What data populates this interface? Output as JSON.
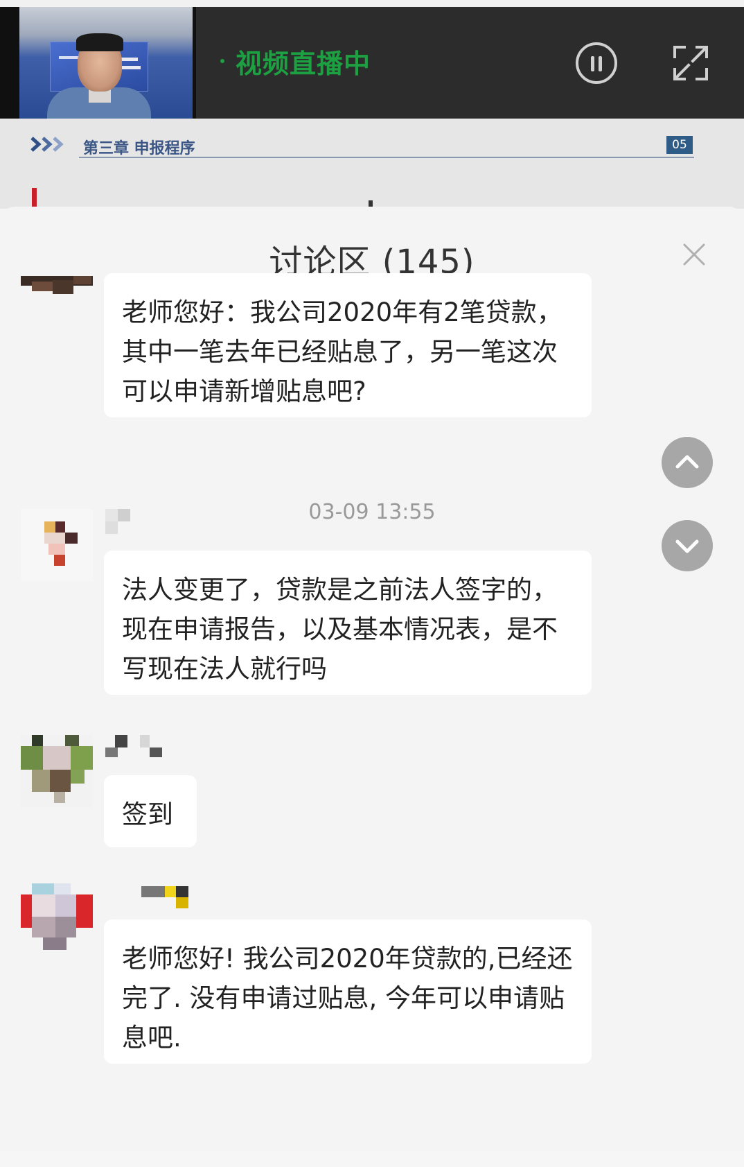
{
  "video": {
    "status_label": "视频直播中",
    "slide": {
      "chapter": "第三章  申报程序",
      "page": "05"
    }
  },
  "discussion": {
    "title": "讨论区 (145)",
    "messages": [
      {
        "text": "老师您好：我公司2020年有2笔贷款，其中一笔去年已经贴息了，另一笔这次可以申请新增贴息吧?"
      },
      {
        "timestamp": "03-09 13:55"
      },
      {
        "text": "法人变更了，贷款是之前法人签字的，现在申请报告，以及基本情况表，是不写现在法人就行吗"
      },
      {
        "text": "签到"
      },
      {
        "text": "老师您好! 我公司2020年贷款的,已经还完了. 没有申请过贴息, 今年可以申请贴息吧."
      }
    ]
  },
  "icons": {
    "pause": "pause-icon",
    "fullscreen": "fullscreen-icon",
    "close": "close-icon",
    "scroll_up": "chevron-up-icon",
    "scroll_down": "chevron-down-icon"
  },
  "colors": {
    "live_green": "#1da042",
    "video_bar": "#2c2c2c",
    "sheet_bg": "#f4f4f4",
    "bubble_bg": "#ffffff",
    "scroll_button": "#a7a7a7"
  }
}
